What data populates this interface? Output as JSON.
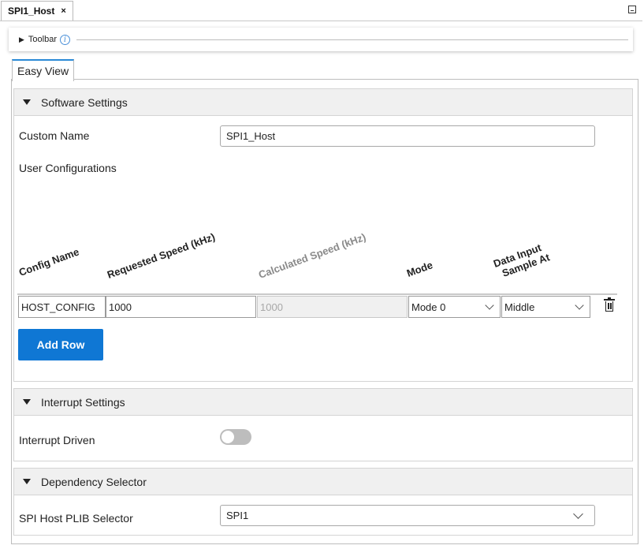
{
  "document_tab": {
    "title": "SPI1_Host",
    "close": "×"
  },
  "toolbar": {
    "label": "Toolbar",
    "info_glyph": "i"
  },
  "view_tab": {
    "label": "Easy View"
  },
  "software_settings": {
    "title": "Software Settings",
    "custom_name_label": "Custom Name",
    "custom_name_value": "SPI1_Host",
    "user_configurations_label": "User Configurations",
    "columns": {
      "config_name": "Config Name",
      "requested_speed": "Requested Speed (kHz)",
      "calculated_speed": "Calculated Speed (kHz)",
      "mode": "Mode",
      "data_input_line1": "Data Input",
      "data_input_line2": "Sample At"
    },
    "rows": [
      {
        "config_name": "HOST_CONFIG",
        "requested_speed": "1000",
        "calculated_speed": "1000",
        "mode": "Mode 0",
        "sample_at": "Middle"
      }
    ],
    "add_row_label": "Add Row"
  },
  "interrupt_settings": {
    "title": "Interrupt Settings",
    "interrupt_driven_label": "Interrupt Driven",
    "interrupt_driven_enabled": false
  },
  "dependency_selector": {
    "title": "Dependency Selector",
    "plib_label": "SPI Host PLIB Selector",
    "plib_value": "SPI1"
  },
  "colors": {
    "accent": "#0f77d4",
    "tab_border": "#2a8ad6",
    "section_header_bg": "#f0f0f0"
  },
  "icons": {
    "delete": "trash-icon",
    "info": "info-icon",
    "expand": "caret-down-icon",
    "minimize": "minimize-icon"
  }
}
